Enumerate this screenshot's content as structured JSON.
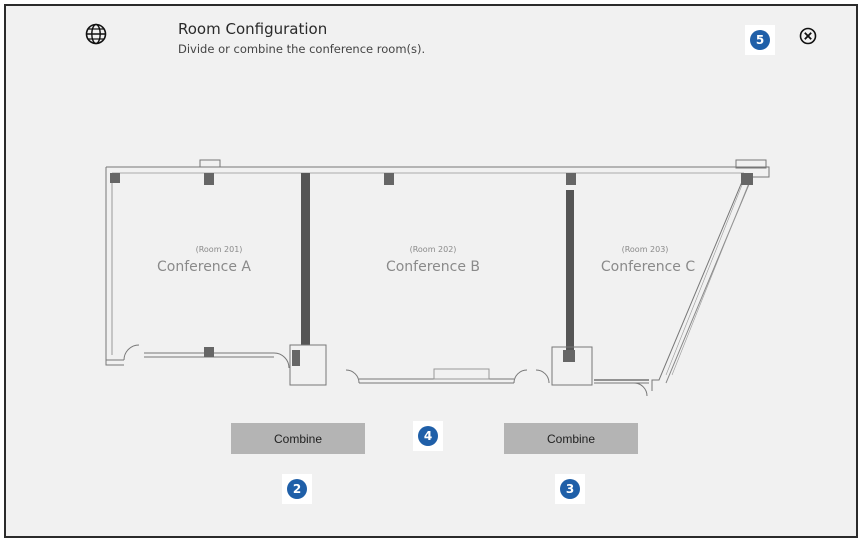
{
  "header": {
    "title": "Room Configuration",
    "subtitle": "Divide or combine the conference room(s)."
  },
  "icons": {
    "globe": "globe-icon",
    "close": "close-circle-x-icon"
  },
  "rooms": [
    {
      "number": "(Room 201)",
      "name": "Conference A"
    },
    {
      "number": "(Room 202)",
      "name": "Conference B"
    },
    {
      "number": "(Room 203)",
      "name": "Conference C"
    }
  ],
  "buttons": {
    "combine_ab": "Combine",
    "combine_bc": "Combine"
  },
  "badges": {
    "b2": "2",
    "b3": "3",
    "b4": "4",
    "b5": "5"
  },
  "colors": {
    "badge": "#1f5fa8",
    "button": "#b4b4b4",
    "background": "#f1f1f1"
  }
}
